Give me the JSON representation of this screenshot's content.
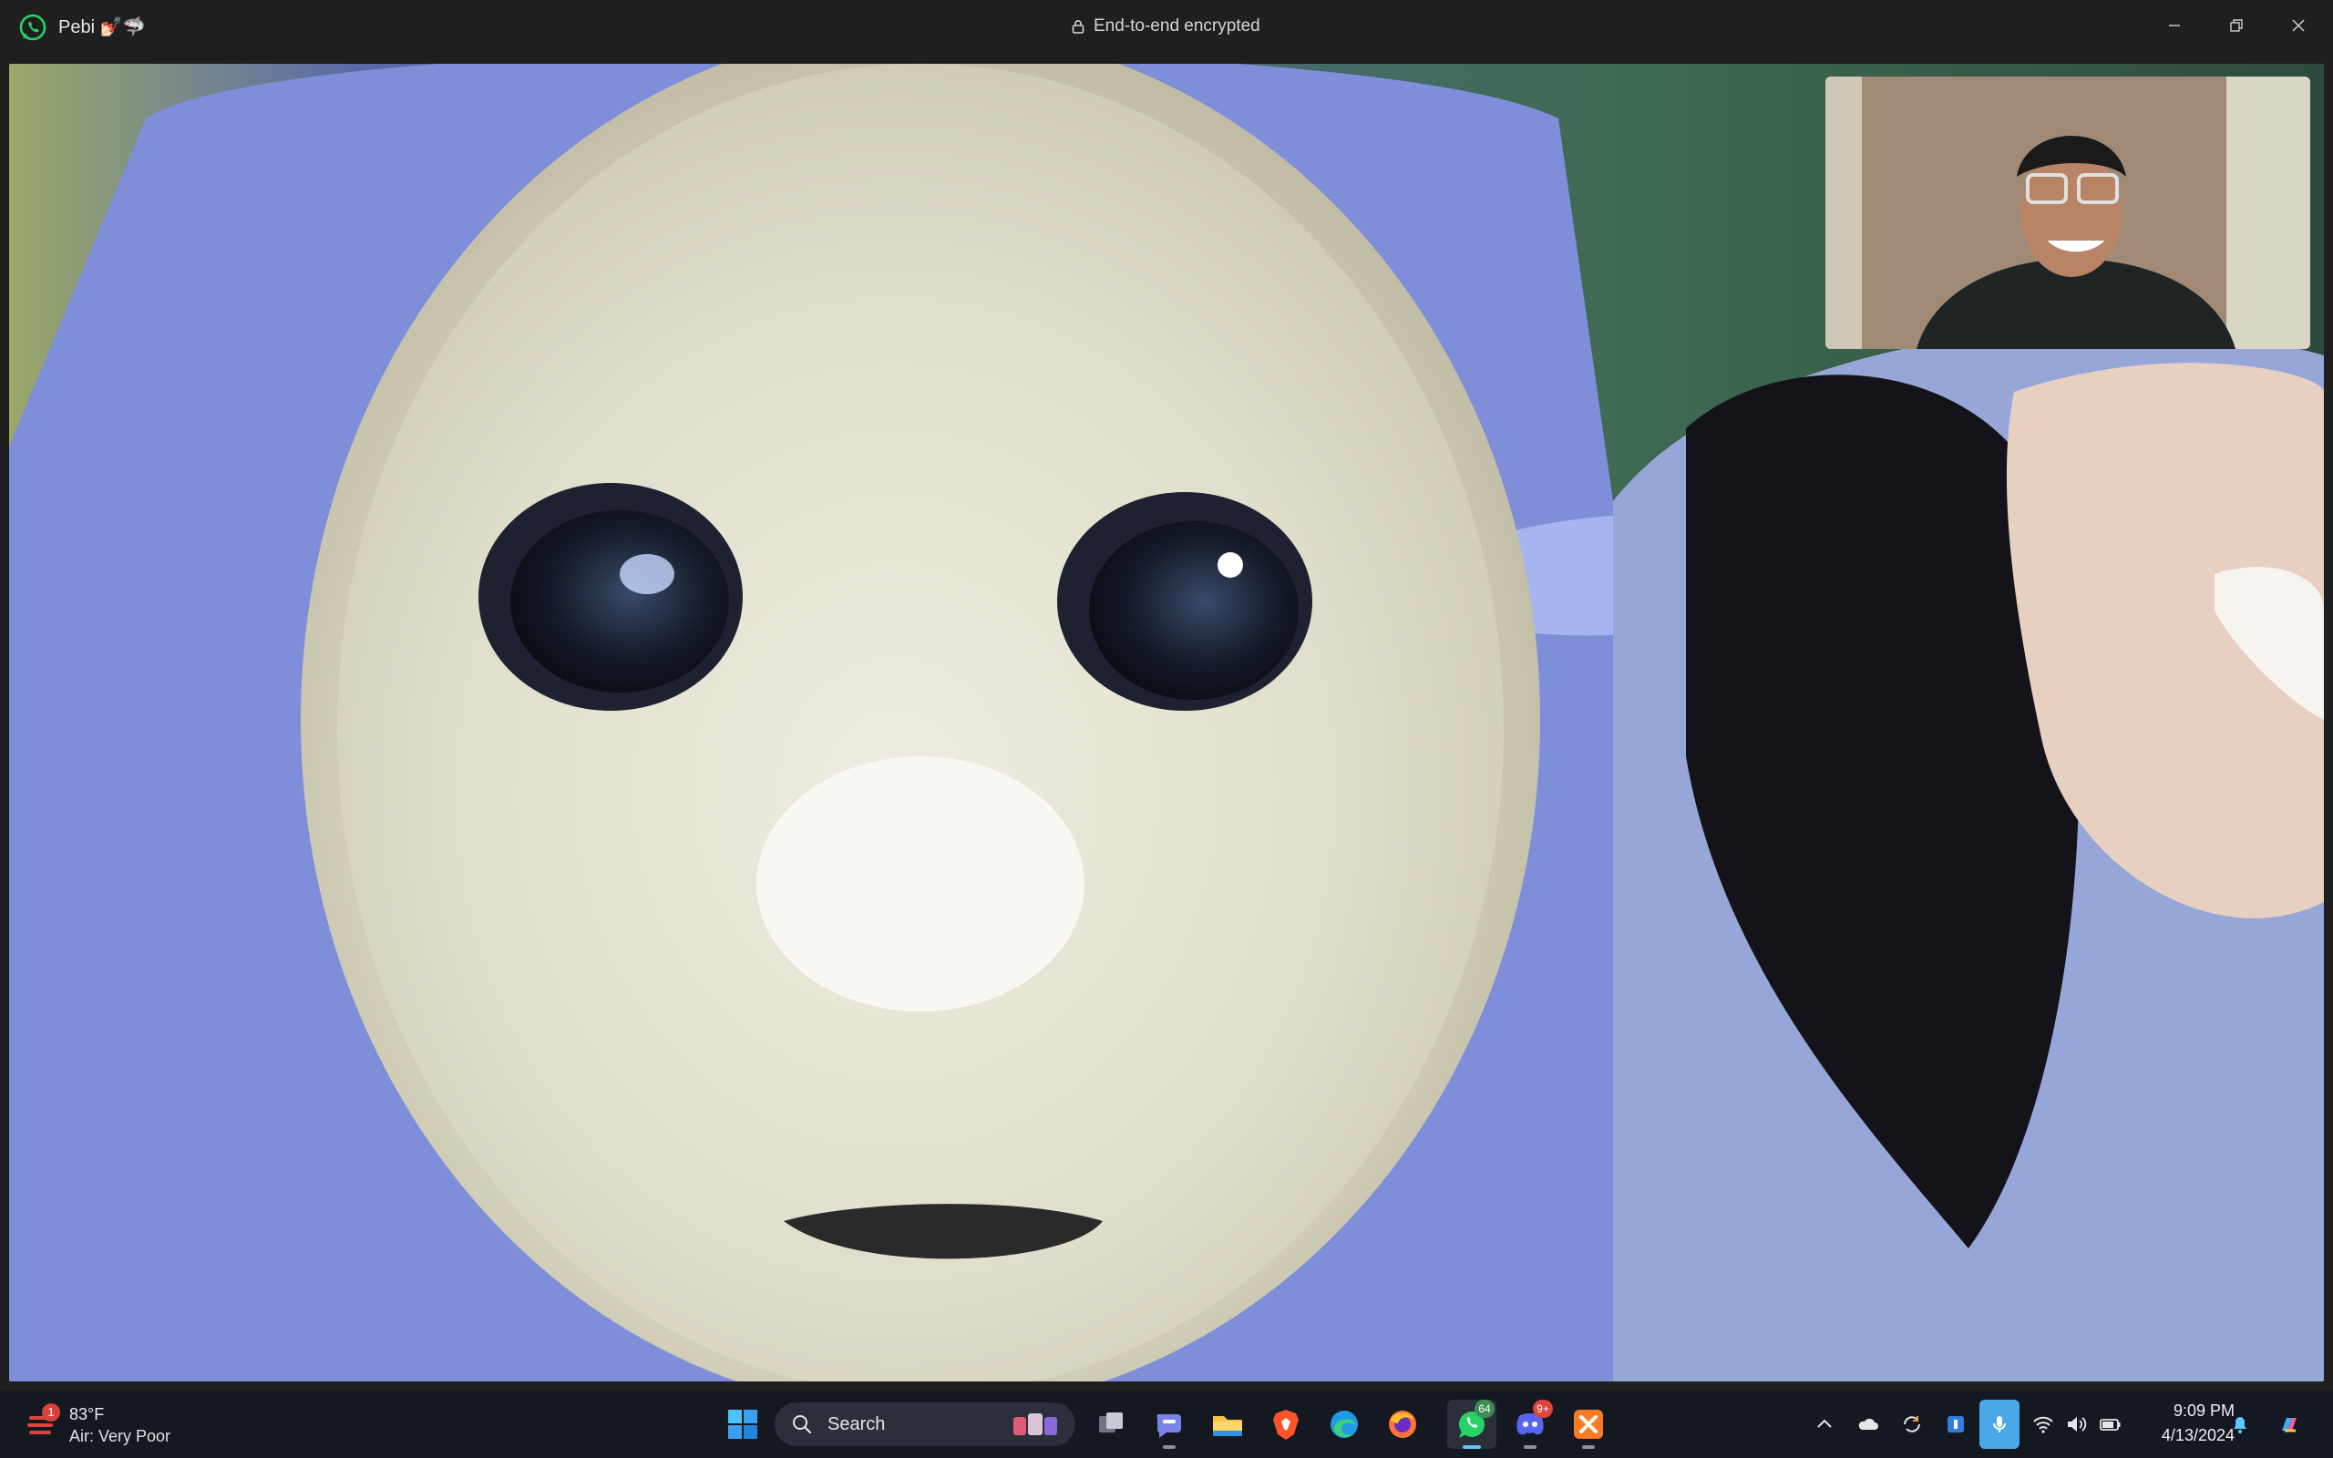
{
  "window": {
    "contact_name": "Pebi 💅🏻🦈",
    "encryption_label": "End-to-end encrypted"
  },
  "call": {
    "remote_video": "remote-participant-video",
    "self_view": "local-camera-preview"
  },
  "taskbar": {
    "weather": {
      "temperature": "83°F",
      "air_quality": "Air: Very Poor",
      "badge": "1"
    },
    "search_label": "Search",
    "pinned_apps": [
      {
        "name": "start-icon"
      },
      {
        "name": "task-view-icon"
      },
      {
        "name": "teams-chat-icon"
      },
      {
        "name": "file-explorer-icon"
      },
      {
        "name": "brave-browser-icon"
      },
      {
        "name": "edge-browser-icon"
      },
      {
        "name": "firefox-icon"
      },
      {
        "name": "whatsapp-icon",
        "badge": "64"
      },
      {
        "name": "discord-icon",
        "badge": "9+"
      },
      {
        "name": "xampp-icon"
      }
    ],
    "clock": {
      "time": "9:09 PM",
      "date": "4/13/2024"
    }
  },
  "colors": {
    "titlebar_bg": "#1f1f1f",
    "taskbar_bg": "#141821",
    "whatsapp_green": "#25d366",
    "mic_active": "#4aa8e8"
  }
}
